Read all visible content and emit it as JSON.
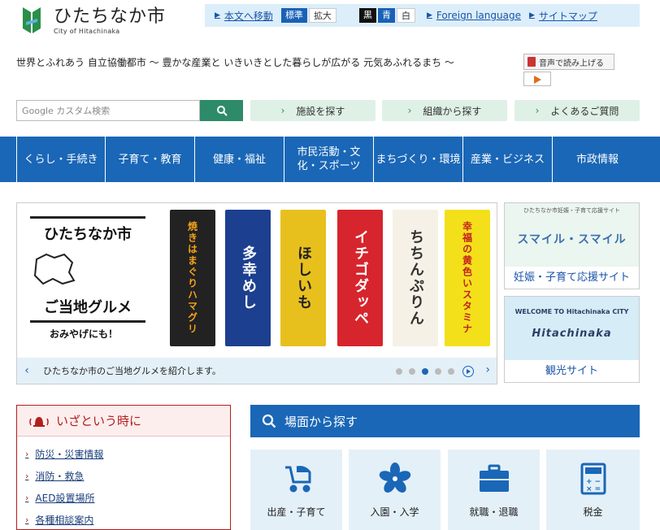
{
  "header": {
    "logo_jp": "ひたちなか市",
    "logo_en": "City of Hitachinaka",
    "skip_link": "本文へ移動",
    "font_standard": "標準",
    "font_large": "拡大",
    "color_black": "黒",
    "color_blue": "青",
    "color_white": "白",
    "foreign_language": "Foreign language",
    "sitemap": "サイトマップ",
    "catchphrase": "世界とふれあう 自立協働都市 〜 豊かな産業と いきいきとした暮らしが広がる 元気あふれるまち 〜",
    "tts_label": "音声で読み上げる"
  },
  "search": {
    "placeholder": "Google カスタム検索"
  },
  "quick_links": [
    {
      "label": "施設を探す"
    },
    {
      "label": "組織から探す"
    },
    {
      "label": "よくあるご質問"
    }
  ],
  "gnav": [
    {
      "label": "くらし・手続き"
    },
    {
      "label": "子育て・教育"
    },
    {
      "label": "健康・福祉"
    },
    {
      "label": "市民活動・文化・スポーツ"
    },
    {
      "label": "まちづくり・環境"
    },
    {
      "label": "産業・ビジネス"
    },
    {
      "label": "市政情報"
    }
  ],
  "slider": {
    "title_city": "ひたちなか市",
    "title_sub": "ご当地グルメ",
    "title_note": "おみやげにも！",
    "banners": [
      {
        "text": "焼きはまぐりハマグリ",
        "bg": "#222",
        "fg": "#f6a21a"
      },
      {
        "text": "多幸めし",
        "bg": "#1c3f8f",
        "fg": "#fff"
      },
      {
        "text": "ほしいも",
        "bg": "#e8c01e",
        "fg": "#222"
      },
      {
        "text": "イチゴダッペ",
        "bg": "#d6252d",
        "fg": "#fff"
      },
      {
        "text": "ちちんぷりん",
        "bg": "#f6f1e6",
        "fg": "#333"
      },
      {
        "text": "幸福の黄色いスタミナ",
        "bg": "#f3e01a",
        "fg": "#c3211d"
      }
    ],
    "caption": "ひたちなか市のご当地グルメを紹介します。",
    "active_dot": 3,
    "dot_count": 5
  },
  "side_banners": [
    {
      "small": "ひたちなか市妊娠・子育て応援サイト",
      "main": "スマイル・スマイル",
      "label": "妊娠・子育て応援サイト"
    },
    {
      "small": "WELCOME TO Hitachinaka CITY",
      "main": "Hitachinaka",
      "label": "観光サイト"
    }
  ],
  "emergency": {
    "title": "いざという時に",
    "items": [
      {
        "label": "防災・災害情報"
      },
      {
        "label": "消防・救急"
      },
      {
        "label": "AED設置場所"
      },
      {
        "label": "各種相談案内"
      }
    ]
  },
  "scene": {
    "title": "場面から探す",
    "items": [
      {
        "label": "出産・子育て",
        "icon": "stroller-icon"
      },
      {
        "label": "入園・入学",
        "icon": "cherry-blossom-icon"
      },
      {
        "label": "就職・退職",
        "icon": "briefcase-icon"
      },
      {
        "label": "税金",
        "icon": "calculator-icon"
      }
    ]
  },
  "colors": {
    "primary_blue": "#1a67b7",
    "green": "#2e8b6a",
    "emergency_red": "#b21e1e"
  }
}
